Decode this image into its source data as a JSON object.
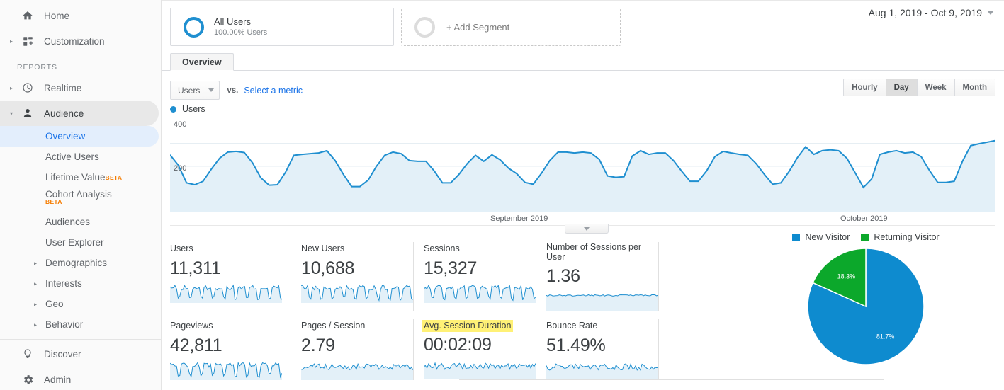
{
  "sidebar": {
    "top_items": [
      {
        "label": "Home",
        "icon": "home-icon",
        "expandable": false
      },
      {
        "label": "Customization",
        "icon": "customization-icon",
        "expandable": true
      }
    ],
    "section_label": "REPORTS",
    "realtime": {
      "label": "Realtime",
      "icon": "clock-icon"
    },
    "audience": {
      "label": "Audience",
      "icon": "person-icon"
    },
    "audience_children": [
      {
        "label": "Overview",
        "selected": true,
        "beta": "",
        "expandable": false
      },
      {
        "label": "Active Users",
        "selected": false,
        "beta": "",
        "expandable": false
      },
      {
        "label": "Lifetime Value",
        "selected": false,
        "beta": "BETA",
        "expandable": false
      },
      {
        "label": "Cohort Analysis",
        "selected": false,
        "beta": "BETA",
        "expandable": false
      },
      {
        "label": "Audiences",
        "selected": false,
        "beta": "",
        "expandable": false
      },
      {
        "label": "User Explorer",
        "selected": false,
        "beta": "",
        "expandable": false
      },
      {
        "label": "Demographics",
        "selected": false,
        "beta": "",
        "expandable": true
      },
      {
        "label": "Interests",
        "selected": false,
        "beta": "",
        "expandable": true
      },
      {
        "label": "Geo",
        "selected": false,
        "beta": "",
        "expandable": true
      },
      {
        "label": "Behavior",
        "selected": false,
        "beta": "",
        "expandable": true
      }
    ],
    "bottom_items": [
      {
        "label": "Discover",
        "icon": "bulb-icon"
      },
      {
        "label": "Admin",
        "icon": "gear-icon"
      }
    ]
  },
  "segments": {
    "applied": {
      "title": "All Users",
      "subtitle": "100.00% Users"
    },
    "add_label": "+ Add Segment"
  },
  "date_range": {
    "label": "Aug 1, 2019 - Oct 9, 2019"
  },
  "tabs": [
    {
      "label": "Overview",
      "active": true
    }
  ],
  "metric_controls": {
    "selected_metric": "Users",
    "vs_label": "vs.",
    "select_metric_link": "Select a metric",
    "granularity": [
      {
        "label": "Hourly",
        "active": false
      },
      {
        "label": "Day",
        "active": true
      },
      {
        "label": "Week",
        "active": false
      },
      {
        "label": "Month",
        "active": false
      }
    ]
  },
  "chart_legend": {
    "series_name": "Users",
    "color": "#1f8fd0"
  },
  "colors": {
    "line_blue": "#1f8fd0",
    "area_blue": "#e3f0f8",
    "pie_blue": "#0e8bcf",
    "pie_green": "#0ca82b",
    "link_blue": "#1a73e8",
    "highlight_yellow": "#fff176",
    "beta_orange": "#f57c00"
  },
  "metric_cards": [
    {
      "label": "Users",
      "value": "11,311",
      "highlighted": false,
      "spark": "oscillating"
    },
    {
      "label": "New Users",
      "value": "10,688",
      "highlighted": false,
      "spark": "oscillating"
    },
    {
      "label": "Sessions",
      "value": "15,327",
      "highlighted": false,
      "spark": "oscillating"
    },
    {
      "label": "Number of Sessions per User",
      "value": "1.36",
      "highlighted": false,
      "spark": "flat"
    },
    {
      "label": "Pageviews",
      "value": "42,811",
      "highlighted": false,
      "spark": "oscillating"
    },
    {
      "label": "Pages / Session",
      "value": "2.79",
      "highlighted": false,
      "spark": "flat-noisy"
    },
    {
      "label": "Avg. Session Duration",
      "value": "00:02:09",
      "highlighted": true,
      "spark": "flat-noisy"
    },
    {
      "label": "Bounce Rate",
      "value": "51.49%",
      "highlighted": false,
      "spark": "flat-noisy"
    }
  ],
  "chart_data": [
    {
      "type": "area",
      "title": "Users",
      "xlabel": "",
      "ylabel": "Users",
      "ylim": [
        0,
        400
      ],
      "yticks": [
        200,
        400
      ],
      "grid": true,
      "x_tick_labels": [
        "September 2019",
        "October 2019"
      ],
      "series": [
        {
          "name": "Users",
          "color": "#1f8fd0",
          "values": [
            250,
            205,
            128,
            120,
            135,
            188,
            235,
            262,
            265,
            260,
            215,
            150,
            118,
            120,
            175,
            248,
            252,
            255,
            258,
            268,
            225,
            165,
            112,
            112,
            140,
            200,
            248,
            262,
            255,
            225,
            222,
            222,
            180,
            128,
            128,
            165,
            212,
            248,
            222,
            250,
            228,
            192,
            168,
            130,
            122,
            170,
            225,
            262,
            262,
            258,
            262,
            258,
            230,
            158,
            152,
            155,
            245,
            268,
            252,
            258,
            258,
            225,
            178,
            135,
            135,
            180,
            242,
            265,
            258,
            252,
            248,
            212,
            165,
            122,
            128,
            178,
            238,
            285,
            252,
            268,
            272,
            268,
            235,
            172,
            108,
            145,
            252,
            262,
            268,
            258,
            262,
            242,
            182,
            130,
            130,
            135,
            222,
            290,
            298,
            305,
            312
          ]
        }
      ]
    },
    {
      "type": "pie",
      "title": "",
      "legend_position": "top",
      "labels": [
        "New Visitor",
        "Returning Visitor"
      ],
      "values": [
        81.7,
        18.3
      ],
      "value_labels": [
        "81.7%",
        "18.3%"
      ],
      "colors": [
        "#0e8bcf",
        "#0ca82b"
      ]
    }
  ],
  "pie": {
    "legend": [
      {
        "label": "New Visitor",
        "color": "#0e8bcf"
      },
      {
        "label": "Returning Visitor",
        "color": "#0ca82b"
      }
    ],
    "slices": [
      {
        "label": "New Visitor",
        "pct_text": "81.7%"
      },
      {
        "label": "Returning Visitor",
        "pct_text": "18.3%"
      }
    ]
  },
  "x_axis": {
    "left_label": "September 2019",
    "right_label": "October 2019"
  }
}
